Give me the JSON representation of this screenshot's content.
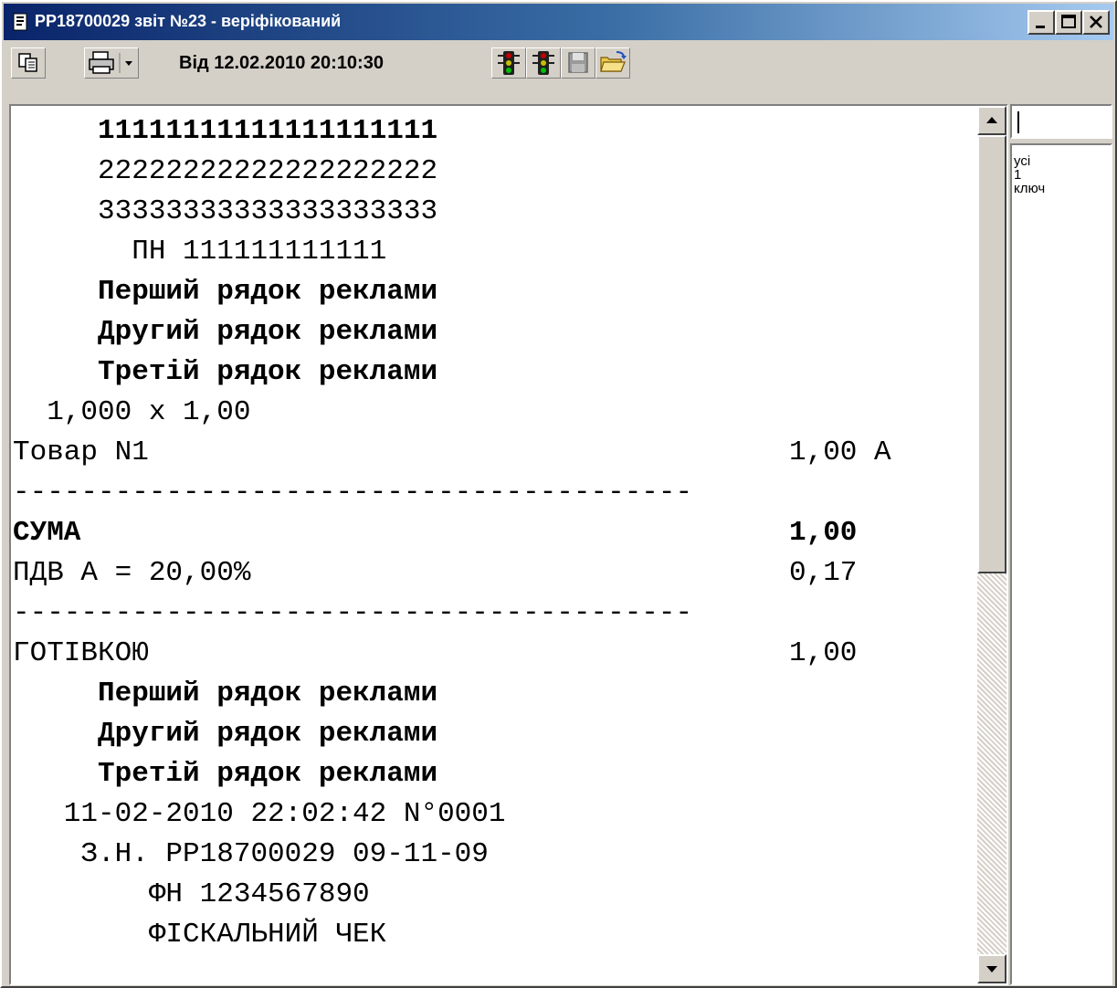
{
  "window": {
    "title": "PP18700029 звіт №23 - веріфікований"
  },
  "toolbar": {
    "date_label": "Від 12.02.2010 20:10:30",
    "icons": [
      "copy-icon",
      "print-icon",
      "dropdown-arrow-icon",
      "traffic-light-icon",
      "traffic-light-icon",
      "save-icon",
      "open-folder-icon"
    ]
  },
  "receipt": {
    "lines": [
      {
        "text": "     11111111111111111111",
        "bold": true
      },
      {
        "text": "     22222222222222222222",
        "bold": false
      },
      {
        "text": "     33333333333333333333",
        "bold": false
      },
      {
        "text": "       ПН 111111111111",
        "bold": false
      },
      {
        "text": "     Перший рядок реклами",
        "bold": true
      },
      {
        "text": "     Другий рядок реклами",
        "bold": true
      },
      {
        "text": "     Третій рядок реклами",
        "bold": true
      },
      {
        "text": "  1,000 x 1,00",
        "bold": false
      },
      {
        "text": "Товар N1",
        "right": "1,00 А",
        "bold": false
      },
      {
        "text": "----------------------------------------",
        "bold": false
      },
      {
        "text": "СУМА",
        "right": "1,00",
        "bold": true
      },
      {
        "text": "ПДВ А = 20,00%",
        "right": "0,17",
        "bold": false
      },
      {
        "text": "----------------------------------------",
        "bold": false
      },
      {
        "text": "ГОТІВКОЮ",
        "right": "1,00",
        "bold": false
      },
      {
        "text": "     Перший рядок реклами",
        "bold": true
      },
      {
        "text": "     Другий рядок реклами",
        "bold": true
      },
      {
        "text": "     Третій рядок реклами",
        "bold": true
      },
      {
        "text": "   11-02-2010 22:02:42 N°0001",
        "bold": false
      },
      {
        "text": "    З.Н. PP18700029 09-11-09",
        "bold": false
      },
      {
        "text": "        ФН 1234567890",
        "bold": false
      },
      {
        "text": "        ФІСКАЛЬНИЙ ЧЕК",
        "bold": false
      }
    ]
  },
  "filter": {
    "input_value": "",
    "items": [
      "усі",
      "1",
      "ключ"
    ]
  }
}
